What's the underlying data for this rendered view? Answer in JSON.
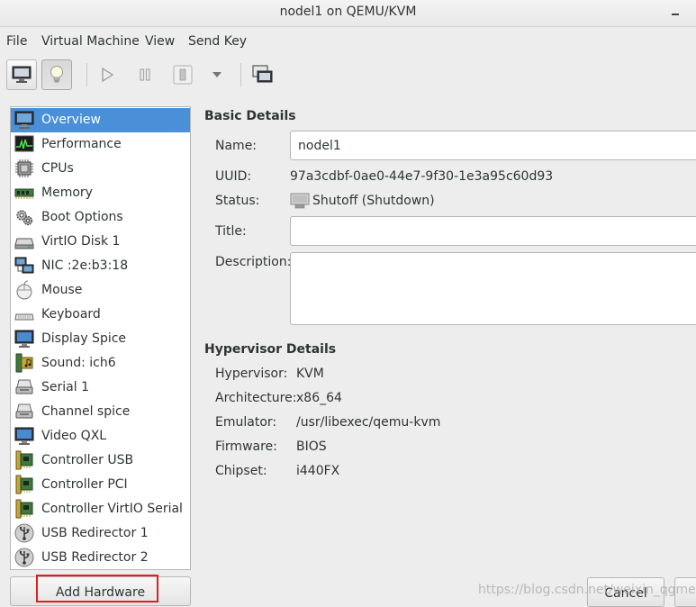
{
  "window": {
    "title": "nodel1 on QEMU/KVM"
  },
  "menu": [
    "File",
    "Virtual Machine",
    "View",
    "Send Key"
  ],
  "toolbar": {
    "console_icon": "monitor-icon",
    "details_icon": "lightbulb-icon",
    "run_icon": "play-icon",
    "pause_icon": "pause-icon",
    "shutdown_icon": "power-icon",
    "menu_icon": "chevron-down-icon",
    "fullscreen_icon": "fullscreen-icon"
  },
  "hardware": [
    {
      "label": "Overview",
      "icon": "monitor-icon",
      "selected": true
    },
    {
      "label": "Performance",
      "icon": "performance-graph-icon"
    },
    {
      "label": "CPUs",
      "icon": "cpu-chip-icon"
    },
    {
      "label": "Memory",
      "icon": "memory-stick-icon"
    },
    {
      "label": "Boot Options",
      "icon": "gears-icon"
    },
    {
      "label": "VirtIO Disk 1",
      "icon": "disk-drive-icon"
    },
    {
      "label": "NIC :2e:b3:18",
      "icon": "network-icon"
    },
    {
      "label": "Mouse",
      "icon": "mouse-icon"
    },
    {
      "label": "Keyboard",
      "icon": "keyboard-icon"
    },
    {
      "label": "Display Spice",
      "icon": "monitor-icon"
    },
    {
      "label": "Sound: ich6",
      "icon": "sound-card-icon"
    },
    {
      "label": "Serial 1",
      "icon": "serial-device-icon"
    },
    {
      "label": "Channel spice",
      "icon": "serial-device-icon"
    },
    {
      "label": "Video QXL",
      "icon": "monitor-icon"
    },
    {
      "label": "Controller USB",
      "icon": "controller-card-icon"
    },
    {
      "label": "Controller PCI",
      "icon": "controller-card-icon"
    },
    {
      "label": "Controller VirtIO Serial",
      "icon": "controller-card-icon"
    },
    {
      "label": "USB Redirector 1",
      "icon": "usb-icon"
    },
    {
      "label": "USB Redirector 2",
      "icon": "usb-icon"
    }
  ],
  "add_hardware_label": "Add Hardware",
  "basic": {
    "heading": "Basic Details",
    "name_label": "Name:",
    "name_value": "nodel1",
    "uuid_label": "UUID:",
    "uuid_value": "97a3cdbf-0ae0-44e7-9f30-1e3a95c60d93",
    "status_label": "Status:",
    "status_value": "Shutoff (Shutdown)",
    "title_label": "Title:",
    "title_value": "",
    "description_label": "Description:",
    "description_value": ""
  },
  "hypervisor": {
    "heading": "Hypervisor Details",
    "hypervisor_label": "Hypervisor:",
    "hypervisor_value": "KVM",
    "arch_label": "Architecture:",
    "arch_value": "x86_64",
    "emulator_label": "Emulator:",
    "emulator_value": "/usr/libexec/qemu-kvm",
    "firmware_label": "Firmware:",
    "firmware_value": "BIOS",
    "chipset_label": "Chipset:",
    "chipset_value": "i440FX"
  },
  "footer": {
    "cancel_label": "Cancel",
    "watermark": "https://blog.csdn.net/weixin_qgmeng"
  },
  "colors": {
    "selection": "#4a90d9",
    "highlight_box": "#e02020"
  }
}
